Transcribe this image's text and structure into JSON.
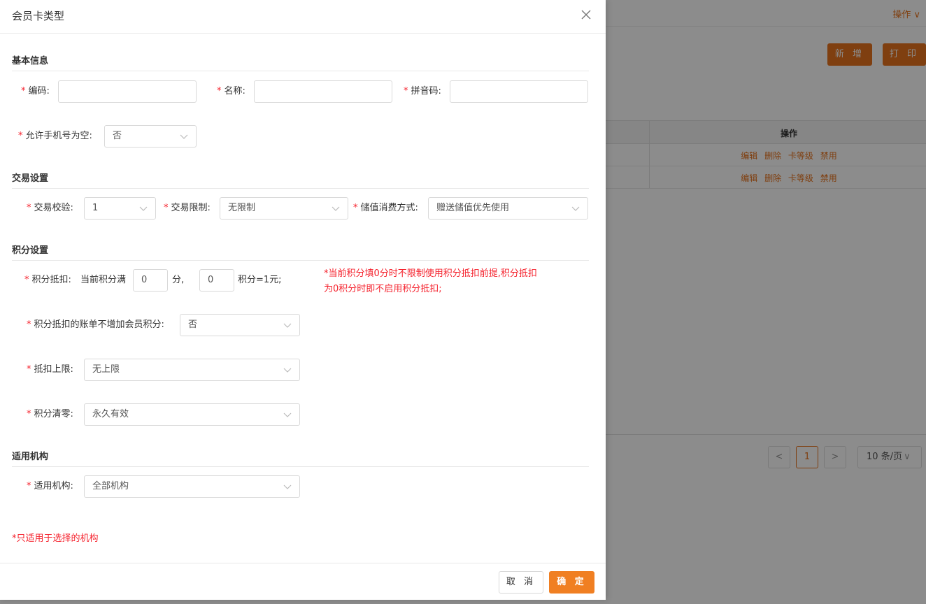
{
  "background": {
    "header_ops": "操作",
    "btn_add": "新 增",
    "btn_print": "打 印",
    "table_header_ops": "操作",
    "rows": [
      {
        "links": [
          "编辑",
          "删除",
          "卡等级",
          "禁用"
        ]
      },
      {
        "links": [
          "编辑",
          "删除",
          "卡等级",
          "禁用"
        ]
      }
    ],
    "pagination": {
      "prev": "<",
      "page": "1",
      "next": ">",
      "size": "10 条/页"
    }
  },
  "drawer": {
    "title": "会员卡类型",
    "sections": {
      "basic": "基本信息",
      "trade": "交易设置",
      "points": "积分设置",
      "org": "适用机构"
    },
    "fields": {
      "code_label": "编码:",
      "code_value": "",
      "name_label": "名称:",
      "name_value": "",
      "pinyin_label": "拼音码:",
      "pinyin_value": "",
      "allow_empty_phone_label": "允许手机号为空:",
      "allow_empty_phone_value": "否",
      "trade_verify_label": "交易校验:",
      "trade_verify_value": "1",
      "trade_limit_label": "交易限制:",
      "trade_limit_value": "无限制",
      "stored_consume_label": "储值消费方式:",
      "stored_consume_value": "赠送储值优先使用",
      "points_deduct_label": "积分抵扣:",
      "points_deduct_prefix": "当前积分满",
      "points_deduct_points": "0",
      "points_deduct_unit": "分,",
      "points_deduct_rate": "0",
      "points_deduct_suffix": "积分=1元;",
      "points_note_line1": "*当前积分填0分时不限制使用积分抵扣前提,积分抵扣",
      "points_note_line2": "为0积分时即不启用积分抵扣;",
      "no_add_points_label": "积分抵扣的账单不增加会员积分:",
      "no_add_points_value": "否",
      "deduct_limit_label": "抵扣上限:",
      "deduct_limit_value": "无上限",
      "points_clear_label": "积分清零:",
      "points_clear_value": "永久有效",
      "org_label": "适用机构:",
      "org_value": "全部机构",
      "org_note": "*只适用于选择的机构"
    },
    "required_mark": "*",
    "footer": {
      "cancel": "取 消",
      "ok": "确 定"
    }
  },
  "colors": {
    "accent": "#f07f22",
    "required": "#f5222d"
  }
}
